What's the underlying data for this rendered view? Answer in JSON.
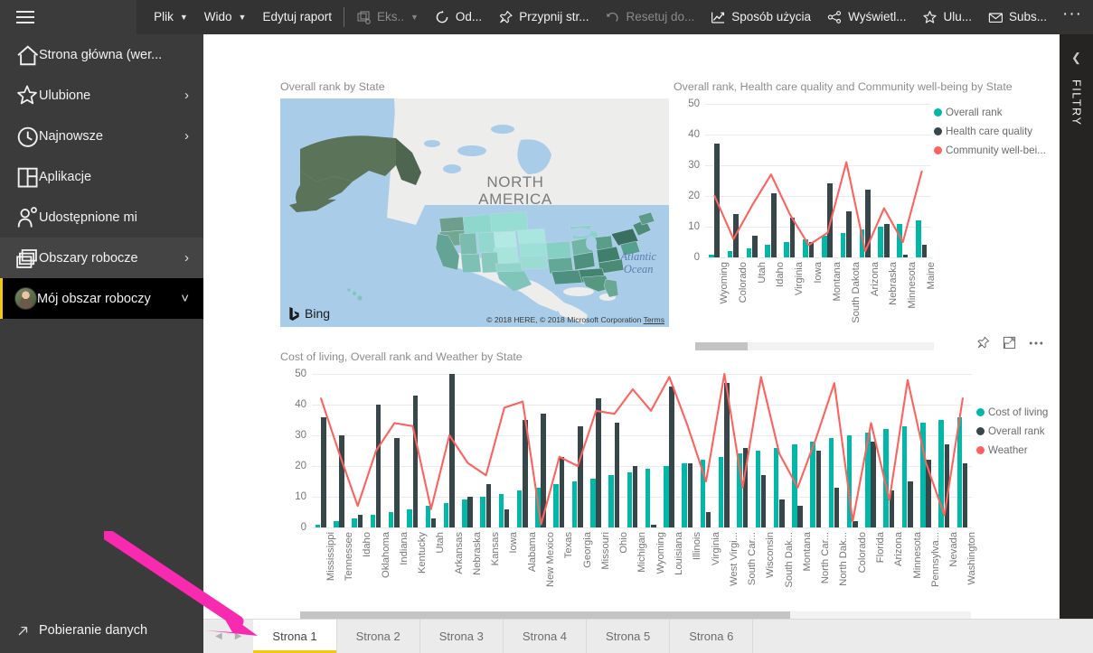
{
  "app": {
    "menu_icon": "hamburger-icon"
  },
  "toolbar": {
    "items": [
      {
        "label": "Plik",
        "icon": "none",
        "chevron": true,
        "disabled": false
      },
      {
        "label": "Wido",
        "icon": "none",
        "chevron": true,
        "disabled": false
      },
      {
        "label": "Edytuj raport",
        "icon": "none",
        "chevron": false,
        "disabled": false
      },
      {
        "label": "Eks..",
        "icon": "export-icon",
        "chevron": true,
        "disabled": true
      },
      {
        "label": "Od...",
        "icon": "refresh-icon",
        "chevron": false,
        "disabled": false
      },
      {
        "label": "Przypnij str...",
        "icon": "pin-icon",
        "chevron": false,
        "disabled": false
      },
      {
        "label": "Resetuj do...",
        "icon": "undo-icon",
        "chevron": false,
        "disabled": true
      },
      {
        "label": "Sposób użycia",
        "icon": "usage-metrics-icon",
        "chevron": false,
        "disabled": false
      },
      {
        "label": "Wyświetl...",
        "icon": "share-nodes-icon",
        "chevron": false,
        "disabled": false
      },
      {
        "label": "Ulu...",
        "icon": "star-icon",
        "chevron": false,
        "disabled": false
      },
      {
        "label": "Subs...",
        "icon": "envelope-icon",
        "chevron": false,
        "disabled": false
      }
    ],
    "more_label": "···"
  },
  "sidebar": {
    "items": [
      {
        "label": "Strona główna (wer...",
        "icon": "home-icon",
        "chevron": false,
        "state": "normal"
      },
      {
        "label": "Ulubione",
        "icon": "star-icon",
        "chevron": true,
        "state": "normal"
      },
      {
        "label": "Najnowsze",
        "icon": "clock-icon",
        "chevron": true,
        "state": "normal"
      },
      {
        "label": "Aplikacje",
        "icon": "apps-icon",
        "chevron": false,
        "state": "normal"
      },
      {
        "label": "Udostępnione mi",
        "icon": "shared-user-icon",
        "chevron": false,
        "state": "normal"
      },
      {
        "label": "Obszary robocze",
        "icon": "workspaces-icon",
        "chevron": true,
        "state": "selected-soft"
      },
      {
        "label": "Mój obszar roboczy",
        "icon": "avatar",
        "chevron": true,
        "chevron_dir": "down",
        "state": "selected-hard"
      }
    ],
    "bottom_item": {
      "label": "Pobieranie danych",
      "icon": "arrow-up-right-icon"
    }
  },
  "filter_panel": {
    "title": "FILTRY",
    "collapse_icon": "chevron-left-icon"
  },
  "visual_actions": {
    "pin_icon": "pin-icon",
    "focus_icon": "focus-mode-icon",
    "more_icon": "more-options-icon"
  },
  "map_visual": {
    "title": "Overall rank by State",
    "provider": "Bing",
    "credit": "© 2018 HERE, © 2018 Microsoft Corporation",
    "credit_link": "Terms",
    "labels": [
      {
        "text": "NORTH\nAMERICA"
      },
      {
        "text": "Atlantic\nOcean"
      }
    ]
  },
  "tabs": {
    "prev_icon": "chevron-left-icon",
    "next_icon": "chevron-right-icon",
    "items": [
      {
        "label": "Strona 1",
        "active": true
      },
      {
        "label": "Strona 2",
        "active": false
      },
      {
        "label": "Strona 3",
        "active": false
      },
      {
        "label": "Strona 4",
        "active": false
      },
      {
        "label": "Strona 5",
        "active": false
      },
      {
        "label": "Strona 6",
        "active": false
      }
    ]
  },
  "colors": {
    "teal": "#00b7a8",
    "dark_slate": "#374649",
    "coral": "#fd625e",
    "accent_yellow": "#f2c811",
    "annotation_pink": "#f72ab0",
    "sidebar_bg": "#3b3b3b",
    "topbar_bg": "#333333"
  },
  "chart_data": [
    {
      "id": "chart_top_right",
      "type": "bar",
      "title": "Overall rank, Health care quality and Community well-being by State",
      "xlabel": "",
      "ylabel": "",
      "ylim": [
        0,
        50
      ],
      "yticks": [
        0,
        10,
        20,
        30,
        40,
        50
      ],
      "grid": true,
      "legend_position": "right",
      "scroll": {
        "visible": true,
        "thumb_start_pct": 0,
        "thumb_width_pct": 22
      },
      "categories": [
        "Wyoming",
        "Colorado",
        "Utah",
        "Idaho",
        "Virginia",
        "Iowa",
        "Montana",
        "South Dakota",
        "Arizona",
        "Nebraska",
        "Minnesota",
        "Maine"
      ],
      "series": [
        {
          "name": "Overall rank",
          "type": "bar",
          "color": "#00b7a8",
          "values": [
            1,
            2,
            3,
            4,
            5,
            6,
            7,
            8,
            9,
            10,
            11,
            12
          ]
        },
        {
          "name": "Health care quality",
          "type": "bar",
          "color": "#374649",
          "values": [
            37,
            14,
            7,
            21,
            13,
            5,
            24,
            15,
            22,
            11,
            1,
            4
          ]
        },
        {
          "name": "Community well-bei...",
          "type": "line",
          "color": "#fd625e",
          "values": [
            20,
            6,
            17,
            27,
            14,
            4,
            8,
            31,
            2,
            16,
            5,
            28
          ]
        }
      ]
    },
    {
      "id": "chart_bottom",
      "type": "bar",
      "title": "Cost of living, Overall rank and Weather by State",
      "xlabel": "",
      "ylabel": "",
      "ylim": [
        0,
        50
      ],
      "yticks": [
        0,
        10,
        20,
        30,
        40,
        50
      ],
      "grid": true,
      "legend_position": "right",
      "scroll": {
        "visible": true,
        "thumb_start_pct": 0,
        "thumb_width_pct": 73
      },
      "categories": [
        "Mississippi",
        "Tennessee",
        "Idaho",
        "Oklahoma",
        "Indiana",
        "Kentucky",
        "Utah",
        "Arkansas",
        "Nebraska",
        "Kansas",
        "Iowa",
        "Alabama",
        "New Mexico",
        "Texas",
        "Georgia",
        "Missouri",
        "Ohio",
        "Michigan",
        "Wyoming",
        "Louisiana",
        "Illinois",
        "Virginia",
        "West Virgi...",
        "South Car...",
        "Wisconsin",
        "South Dak...",
        "Montana",
        "North Car...",
        "North Dak...",
        "Colorado",
        "Florida",
        "Arizona",
        "Minnesota",
        "Pennsylva...",
        "Nevada",
        "Washington"
      ],
      "series": [
        {
          "name": "Cost of living",
          "type": "bar",
          "color": "#00b7a8",
          "values": [
            1,
            2,
            3,
            4,
            5,
            6,
            7,
            8,
            9,
            10,
            11,
            12,
            13,
            14,
            15,
            16,
            17,
            18,
            19,
            20,
            21,
            22,
            23,
            24,
            25,
            26,
            27,
            28,
            29,
            30,
            31,
            32,
            33,
            34,
            35,
            36
          ]
        },
        {
          "name": "Overall rank",
          "type": "bar",
          "color": "#374649",
          "values": [
            36,
            30,
            4,
            40,
            29,
            43,
            3,
            50,
            10,
            14,
            6,
            35,
            37,
            23,
            33,
            42,
            34,
            20,
            1,
            46,
            21,
            5,
            47,
            26,
            17,
            9,
            7,
            25,
            13,
            2,
            28,
            12,
            15,
            22,
            27,
            21
          ]
        },
        {
          "name": "Weather",
          "type": "line",
          "color": "#fd625e",
          "values": [
            42,
            24,
            7,
            25,
            34,
            33,
            6,
            30,
            21,
            17,
            39,
            41,
            1,
            23,
            20,
            38,
            37,
            45,
            38,
            49,
            33,
            15,
            50,
            13,
            49,
            24,
            13,
            29,
            47,
            2,
            34,
            9,
            48,
            21,
            4,
            42
          ]
        }
      ]
    }
  ]
}
